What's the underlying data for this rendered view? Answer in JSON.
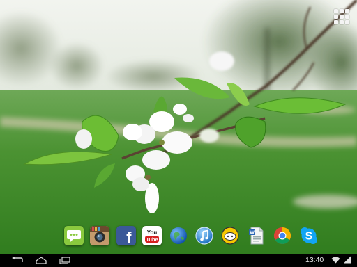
{
  "wallpaper": {
    "description": "cherry-blossom",
    "colors": {
      "grass": "#3c8a2a",
      "sky": "#e8eee6",
      "blossom": "#ffffff",
      "leaf": "#5aa832"
    }
  },
  "home": {
    "app_drawer_icon": "app-drawer-grid-icon"
  },
  "dock": {
    "apps": [
      {
        "name": "messaging",
        "icon": "messaging-icon",
        "color": "#7cc43a"
      },
      {
        "name": "instagram",
        "icon": "instagram-icon",
        "color": "#c7a37b"
      },
      {
        "name": "facebook",
        "icon": "facebook-icon",
        "color": "#3b5998",
        "glyph": "f"
      },
      {
        "name": "youtube",
        "icon": "youtube-icon",
        "color": "#ffffff",
        "glyph": "You\nTube"
      },
      {
        "name": "browser",
        "icon": "globe-icon",
        "color": "#2a6fc9"
      },
      {
        "name": "music",
        "icon": "music-note-icon",
        "color": "#2a8fd8"
      },
      {
        "name": "chat",
        "icon": "chat-bubble-icon",
        "color": "#f5c400"
      },
      {
        "name": "documents",
        "icon": "document-icon",
        "color": "#f0f0f0"
      },
      {
        "name": "chrome",
        "icon": "chrome-icon",
        "color": "#e34133"
      },
      {
        "name": "skype",
        "icon": "skype-icon",
        "color": "#12a5f4",
        "glyph": "S"
      }
    ]
  },
  "navbar": {
    "back_icon": "back-arrow-icon",
    "home_icon": "home-icon",
    "recents_icon": "recent-apps-icon"
  },
  "status": {
    "time": "13:40",
    "wifi_icon": "wifi-icon",
    "signal_icon": "signal-icon"
  }
}
